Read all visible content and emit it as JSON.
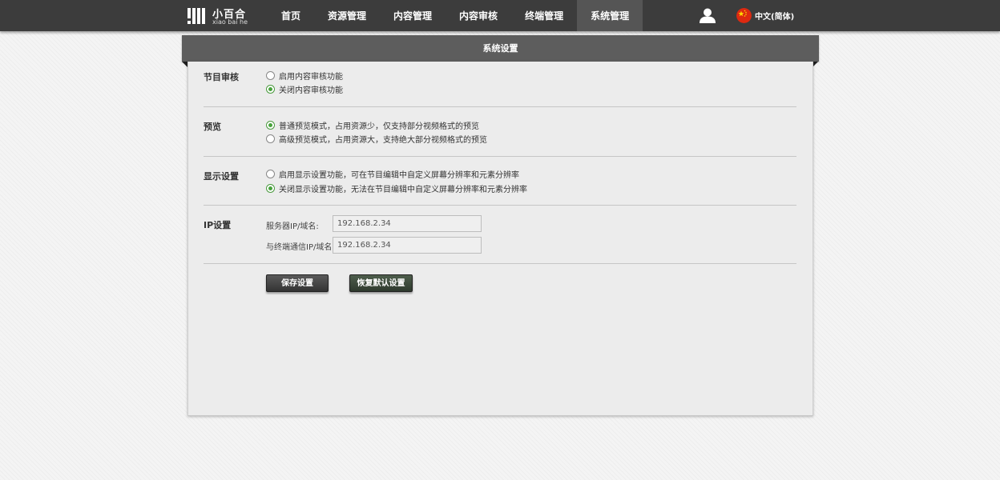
{
  "header": {
    "logo": {
      "name": "小百合",
      "sub": "xiao bai he"
    },
    "nav": [
      {
        "label": "首页",
        "active": false
      },
      {
        "label": "资源管理",
        "active": false
      },
      {
        "label": "内容管理",
        "active": false
      },
      {
        "label": "内容审核",
        "active": false
      },
      {
        "label": "终端管理",
        "active": false
      },
      {
        "label": "系统管理",
        "active": true
      }
    ],
    "user_icon": "user-icon",
    "language": {
      "flag_icon": "china-flag-icon",
      "label": "中文(简体)"
    }
  },
  "panel": {
    "title": "系统设置",
    "sections": {
      "program_review": {
        "label": "节目审核",
        "options": [
          {
            "label": "启用内容审核功能",
            "checked": false
          },
          {
            "label": "关闭内容审核功能",
            "checked": true
          }
        ]
      },
      "preview": {
        "label": "预览",
        "options": [
          {
            "label": "普通预览模式，占用资源少，仅支持部分视频格式的预览",
            "checked": true
          },
          {
            "label": "高级预览模式，占用资源大，支持绝大部分视频格式的预览",
            "checked": false
          }
        ]
      },
      "display": {
        "label": "显示设置",
        "options": [
          {
            "label": "启用显示设置功能，可在节目编辑中自定义屏幕分辨率和元素分辨率",
            "checked": false
          },
          {
            "label": "关闭显示设置功能，无法在节目编辑中自定义屏幕分辨率和元素分辨率",
            "checked": true
          }
        ]
      },
      "ip": {
        "label": "IP设置",
        "server_label": "服务器IP/域名:",
        "server_value": "192.168.2.34",
        "terminal_label": "与终端通信IP/域名:",
        "terminal_value": "192.168.2.34"
      }
    },
    "buttons": {
      "save": "保存设置",
      "restore": "恢复默认设置"
    }
  },
  "colors": {
    "topbar": "#3c3c3c",
    "nav_active": "#555555",
    "panel_header": "#5d5d5d",
    "radio_checked": "#47a23c"
  }
}
